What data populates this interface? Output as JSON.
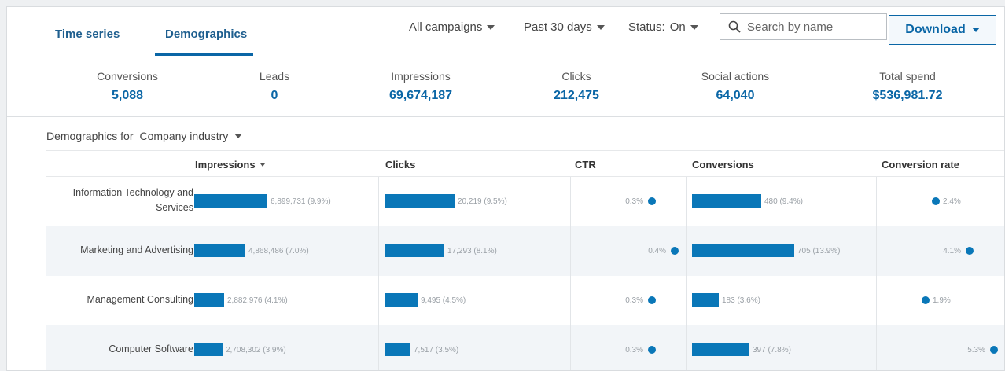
{
  "tabs": [
    {
      "label": "Time series",
      "active": false
    },
    {
      "label": "Demographics",
      "active": true
    }
  ],
  "filters": {
    "campaigns": "All campaigns",
    "range": "Past 30 days",
    "status_label": "Status:",
    "status_value": "On"
  },
  "search": {
    "placeholder": "Search by name"
  },
  "download_label": "Download",
  "metrics": [
    {
      "label": "Conversions",
      "value": "5,088"
    },
    {
      "label": "Leads",
      "value": "0"
    },
    {
      "label": "Impressions",
      "value": "69,674,187"
    },
    {
      "label": "Clicks",
      "value": "212,475"
    },
    {
      "label": "Social actions",
      "value": "64,040"
    },
    {
      "label": "Total spend",
      "value": "$536,981.72"
    }
  ],
  "demographics": {
    "prefix": "Demographics for",
    "selected": "Company industry"
  },
  "columns": [
    "Impressions",
    "Clicks",
    "CTR",
    "Conversions",
    "Conversion rate"
  ],
  "rows": [
    {
      "label_line1": "Information Technology and",
      "label_line2": "Services",
      "impressions_text": "6,899,731 (9.9%)",
      "impressions_fraction": 0.099,
      "clicks_text": "20,219 (9.5%)",
      "clicks_fraction": 0.095,
      "ctr_text": "0.3%",
      "ctr_value": 0.3,
      "conversions_text": "480 (9.4%)",
      "conversions_fraction": 0.094,
      "conv_rate_text": "2.4%",
      "conv_rate_value": 2.4
    },
    {
      "label_line1": "Marketing and Advertising",
      "label_line2": "",
      "impressions_text": "4,868,486 (7.0%)",
      "impressions_fraction": 0.07,
      "clicks_text": "17,293 (8.1%)",
      "clicks_fraction": 0.081,
      "ctr_text": "0.4%",
      "ctr_value": 0.4,
      "conversions_text": "705 (13.9%)",
      "conversions_fraction": 0.139,
      "conv_rate_text": "4.1%",
      "conv_rate_value": 4.1
    },
    {
      "label_line1": "Management Consulting",
      "label_line2": "",
      "impressions_text": "2,882,976 (4.1%)",
      "impressions_fraction": 0.041,
      "clicks_text": "9,495 (4.5%)",
      "clicks_fraction": 0.045,
      "ctr_text": "0.3%",
      "ctr_value": 0.3,
      "conversions_text": "183 (3.6%)",
      "conversions_fraction": 0.036,
      "conv_rate_text": "1.9%",
      "conv_rate_value": 1.9
    },
    {
      "label_line1": "Computer Software",
      "label_line2": "",
      "impressions_text": "2,708,302 (3.9%)",
      "impressions_fraction": 0.039,
      "clicks_text": "7,517 (3.5%)",
      "clicks_fraction": 0.035,
      "ctr_text": "0.3%",
      "ctr_value": 0.3,
      "conversions_text": "397 (7.8%)",
      "conversions_fraction": 0.078,
      "conv_rate_text": "5.3%",
      "conv_rate_value": 5.3
    }
  ],
  "colors": {
    "accent": "#0a66a6",
    "bar": "#0a77b8"
  }
}
